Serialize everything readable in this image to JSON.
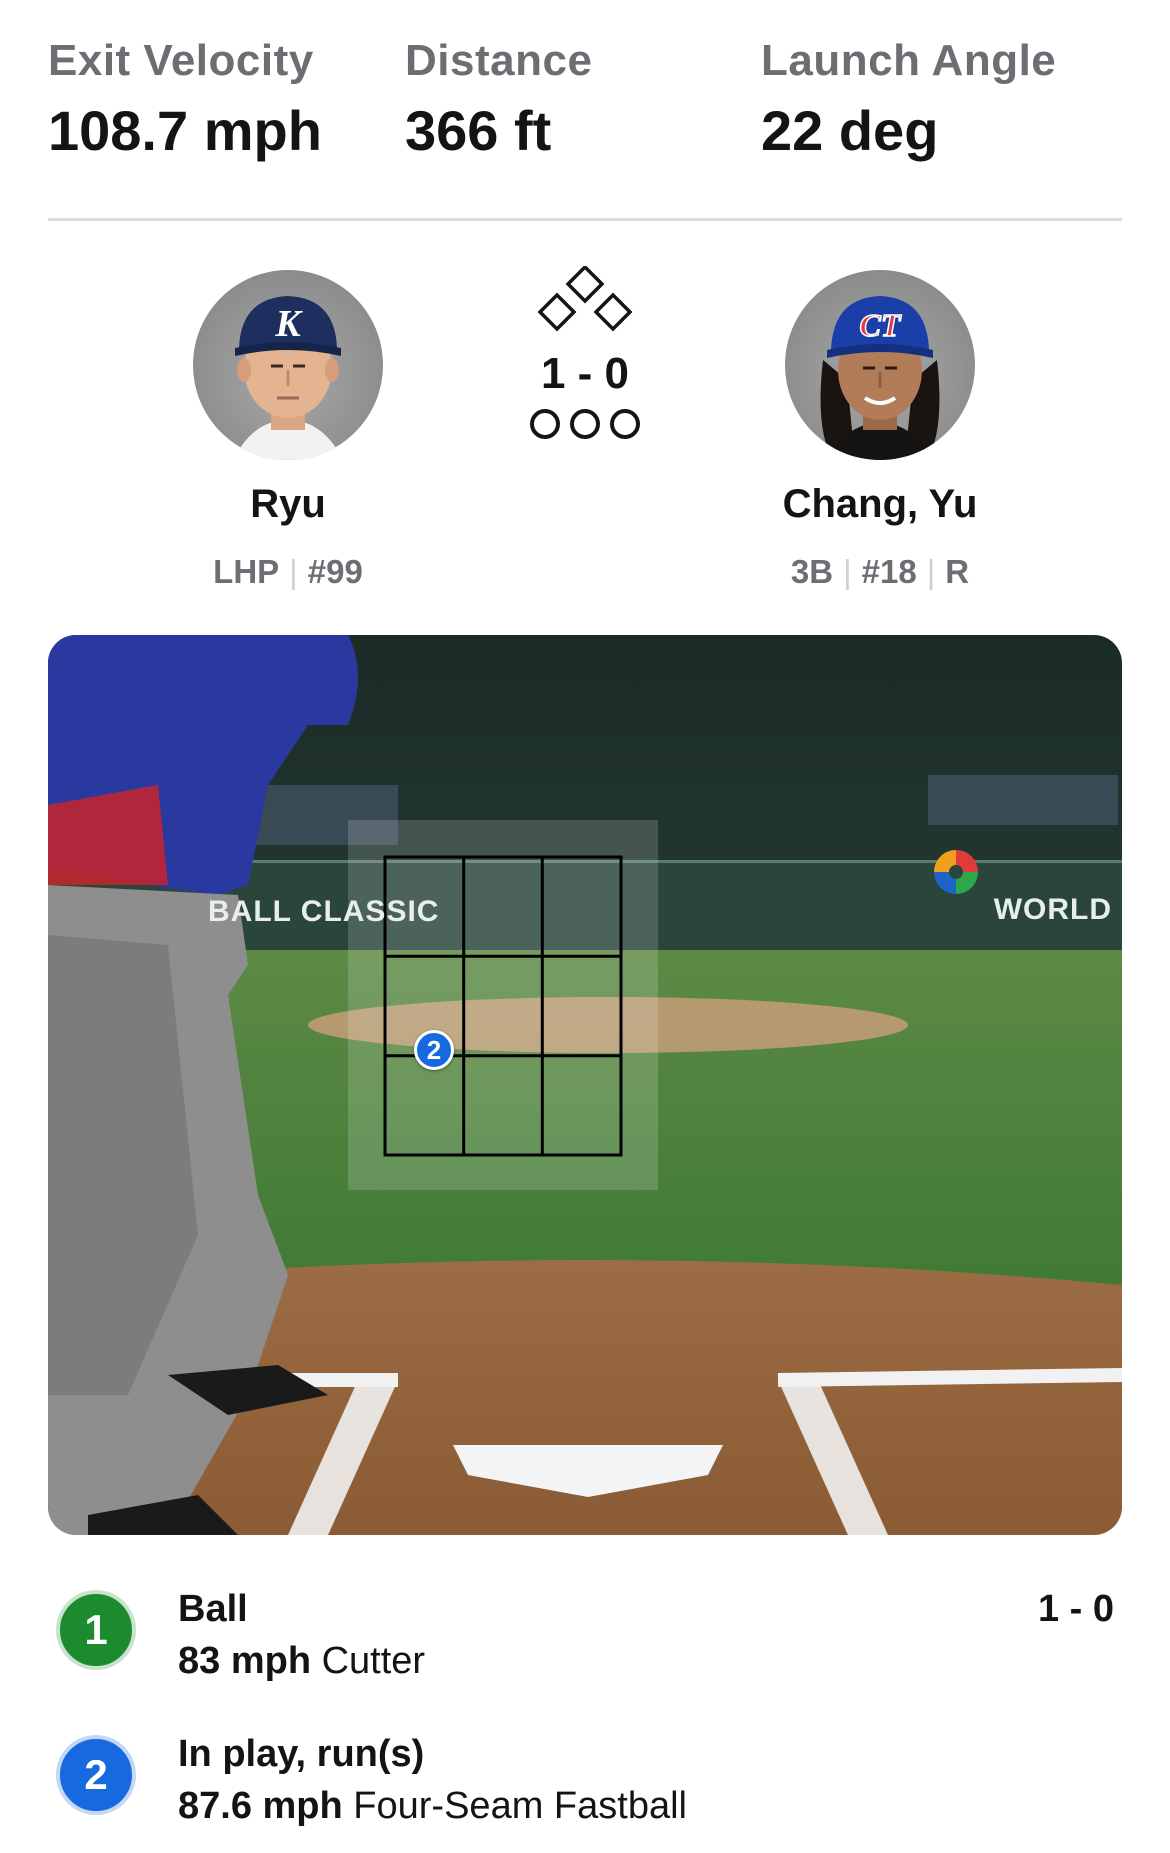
{
  "stats": [
    {
      "label": "Exit Velocity",
      "value": "108.7 mph"
    },
    {
      "label": "Distance",
      "value": "366 ft"
    },
    {
      "label": "Launch Angle",
      "value": "22 deg"
    }
  ],
  "pitcher": {
    "name": "Ryu",
    "pos": "LHP",
    "number": "#99",
    "cap_letter": "K",
    "cap_color": "#1d2f5e"
  },
  "batter": {
    "name": "Chang, Yu",
    "pos": "3B",
    "number": "#18",
    "bats": "R",
    "cap_letter": "CT",
    "cap_color": "#1b3fa8"
  },
  "game_state": {
    "count": "1 - 0",
    "outs": 0,
    "bases_occupied": []
  },
  "scene": {
    "ad_left": "BALL CLASSIC",
    "ad_right": "WORLD"
  },
  "pitches": [
    {
      "num": "1",
      "result": "Ball",
      "speed": "83 mph",
      "type": "Cutter",
      "count": "1 - 0",
      "color": "green"
    },
    {
      "num": "2",
      "result": "In play, run(s)",
      "speed": "87.6 mph",
      "type": "Four-Seam Fastball",
      "count": "",
      "color": "blue"
    }
  ],
  "colors": {
    "ball": "#1c8a2e",
    "in_play": "#1769e0",
    "label_gray": "#6b6e72"
  }
}
